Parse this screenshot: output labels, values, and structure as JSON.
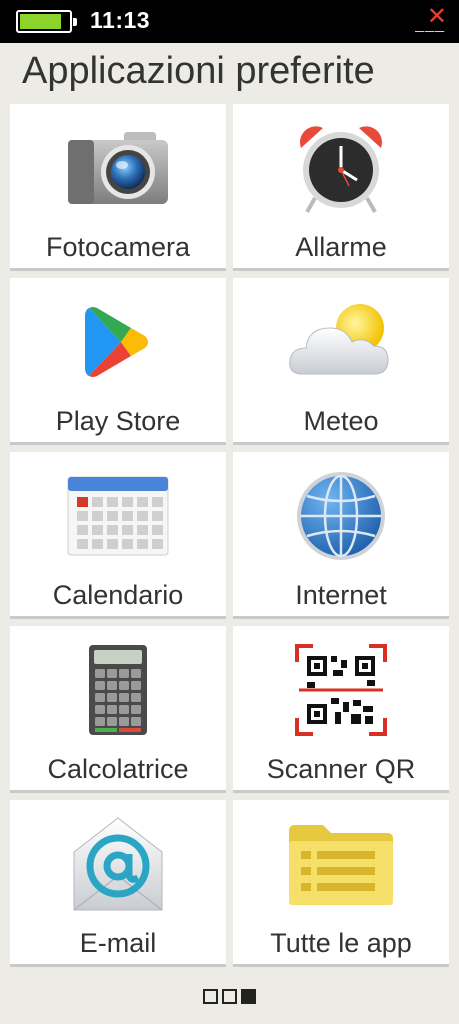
{
  "status": {
    "time": "11:13",
    "battery_level": 0.85,
    "battery_color": "#8bd42a"
  },
  "page": {
    "title": "Applicazioni preferite",
    "close_glyph": "✕",
    "minimize_glyph": "___"
  },
  "apps": [
    {
      "label": "Fotocamera",
      "icon": "camera-icon"
    },
    {
      "label": "Allarme",
      "icon": "alarm-clock-icon"
    },
    {
      "label": "Play Store",
      "icon": "play-store-icon"
    },
    {
      "label": "Meteo",
      "icon": "weather-icon"
    },
    {
      "label": "Calendario",
      "icon": "calendar-icon"
    },
    {
      "label": "Internet",
      "icon": "globe-icon"
    },
    {
      "label": "Calcolatrice",
      "icon": "calculator-icon"
    },
    {
      "label": "Scanner QR",
      "icon": "qr-scanner-icon"
    },
    {
      "label": "E-mail",
      "icon": "email-icon"
    },
    {
      "label": "Tutte le app",
      "icon": "folder-list-icon"
    }
  ],
  "pager": {
    "pages": 3,
    "current": 3
  }
}
